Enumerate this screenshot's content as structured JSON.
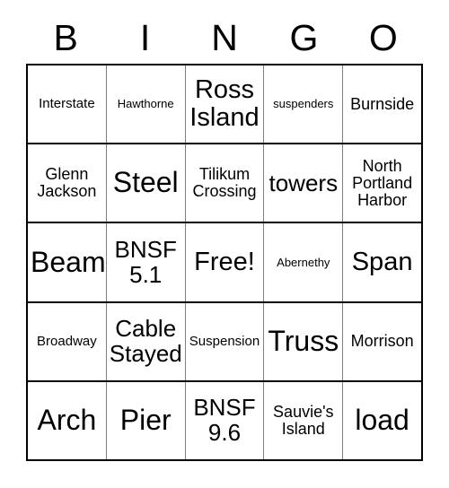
{
  "card": {
    "title": "BINGO",
    "header_letters": [
      "B",
      "I",
      "N",
      "G",
      "O"
    ],
    "free_space_label": "Free!",
    "colors": {
      "background": "#ffffff",
      "text": "#000000",
      "outer_border": "#000000",
      "inner_grid_line": "#808080",
      "row_separator": "#000000"
    },
    "grid": {
      "columns": 5,
      "rows": 5,
      "cells": [
        [
          {
            "text": "Interstate",
            "size": "sm"
          },
          {
            "text": "Hawthorne",
            "size": "xs"
          },
          {
            "text": "Ross\nIsland",
            "size": "2xl"
          },
          {
            "text": "suspenders",
            "size": "xs"
          },
          {
            "text": "Burnside",
            "size": "md"
          }
        ],
        [
          {
            "text": "Glenn\nJackson",
            "size": "md"
          },
          {
            "text": "Steel",
            "size": "3xl"
          },
          {
            "text": "Tilikum\nCrossing",
            "size": "md"
          },
          {
            "text": "towers",
            "size": "xl"
          },
          {
            "text": "North\nPortland\nHarbor",
            "size": "md"
          }
        ],
        [
          {
            "text": "Beam",
            "size": "3xl"
          },
          {
            "text": "BNSF\n5.1",
            "size": "xl"
          },
          {
            "text": "Free!",
            "size": "2xl"
          },
          {
            "text": "Abernethy",
            "size": "xs"
          },
          {
            "text": "Span",
            "size": "2xl"
          }
        ],
        [
          {
            "text": "Broadway",
            "size": "sm"
          },
          {
            "text": "Cable\nStayed",
            "size": "xl"
          },
          {
            "text": "Suspension",
            "size": "sm"
          },
          {
            "text": "Truss",
            "size": "3xl"
          },
          {
            "text": "Morrison",
            "size": "md"
          }
        ],
        [
          {
            "text": "Arch",
            "size": "3xl"
          },
          {
            "text": "Pier",
            "size": "3xl"
          },
          {
            "text": "BNSF\n9.6",
            "size": "xl"
          },
          {
            "text": "Sauvie's\nIsland",
            "size": "md"
          },
          {
            "text": "load",
            "size": "3xl"
          }
        ]
      ]
    }
  }
}
